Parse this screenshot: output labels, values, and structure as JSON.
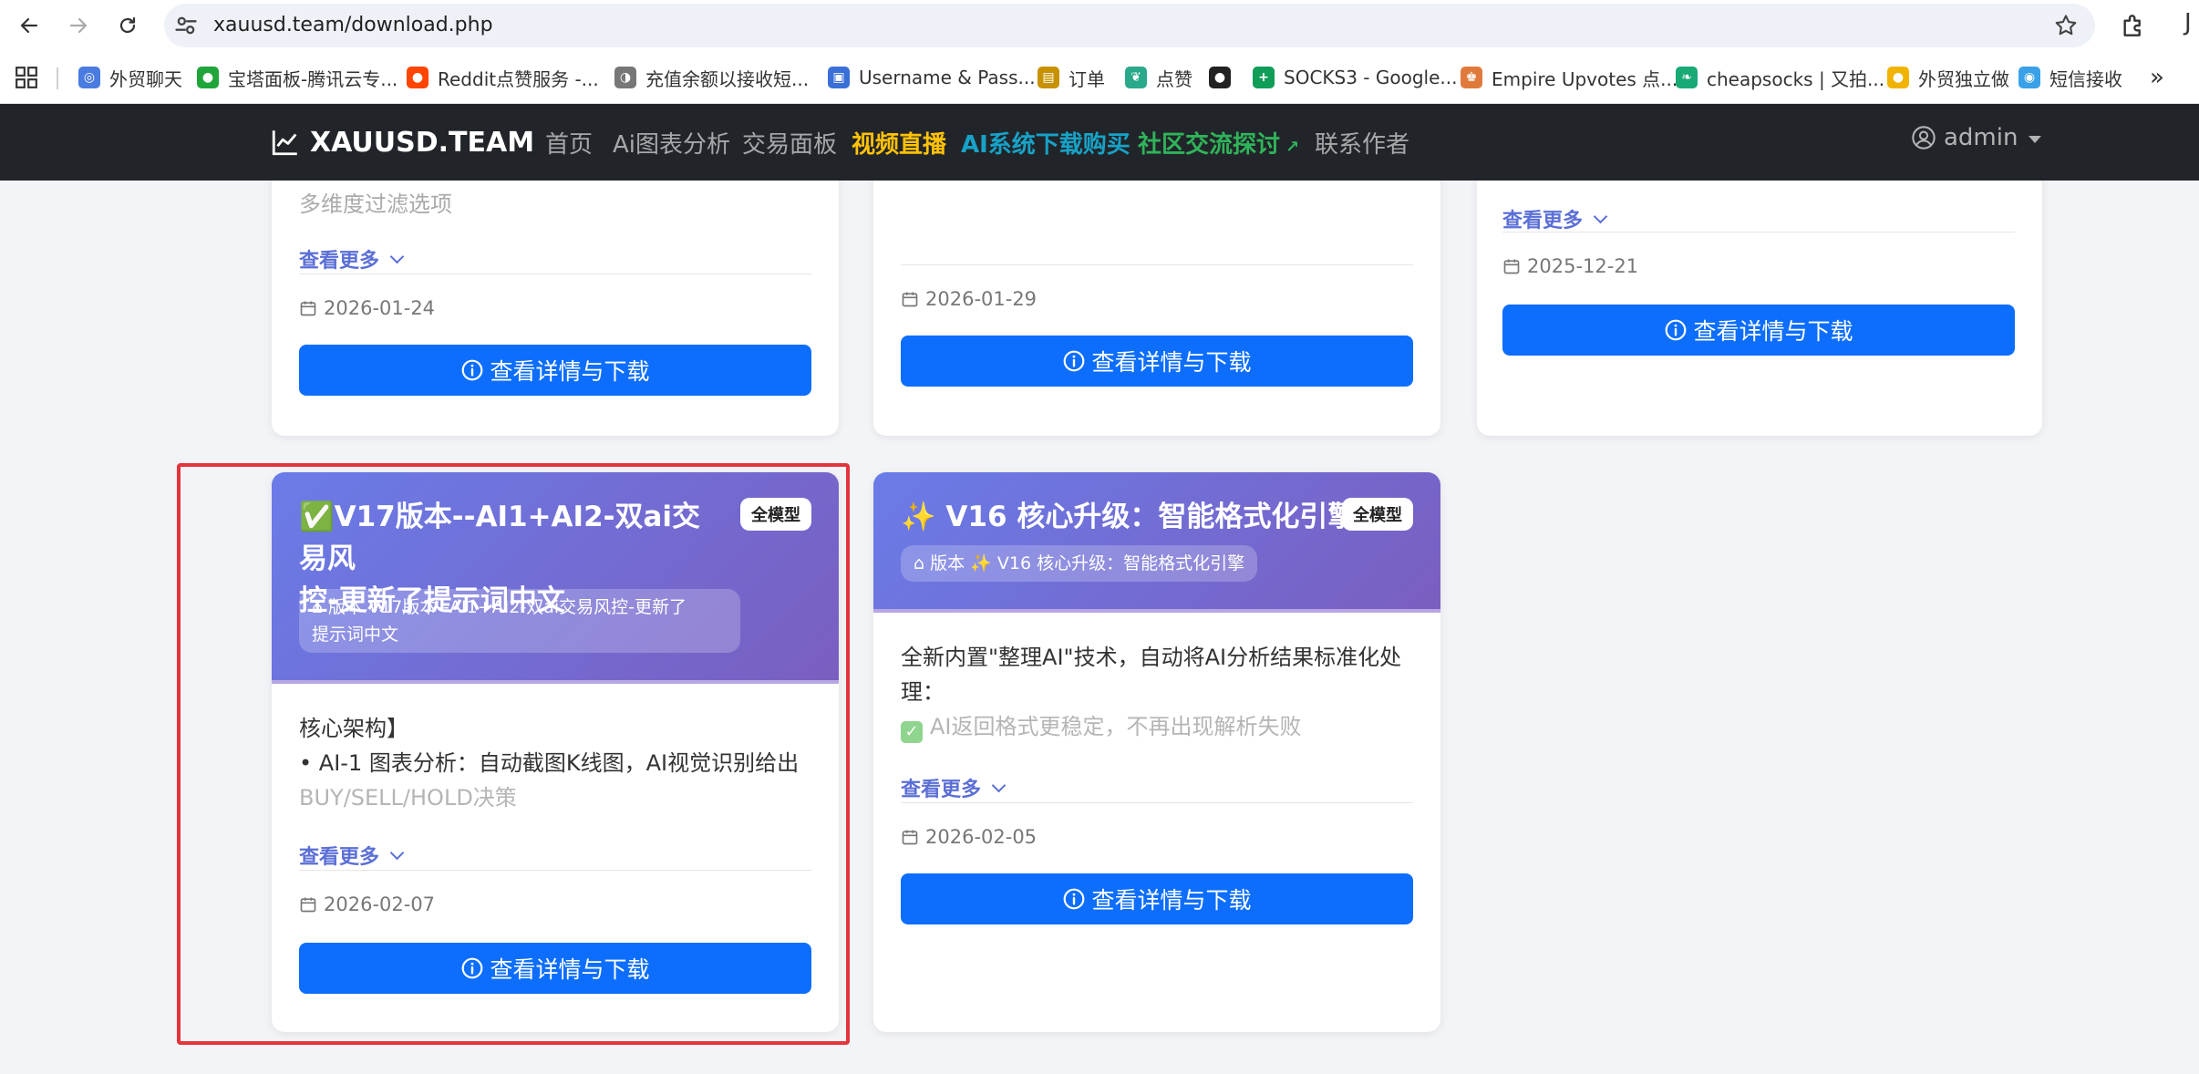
{
  "browser": {
    "url": "xauusd.team/download.php",
    "bookmarks": [
      {
        "label": "外贸聊天",
        "icon": "chat-bubble-icon",
        "color": "#4a7be0"
      },
      {
        "label": "宝塔面板-腾讯云专...",
        "icon": "shield-icon",
        "color": "#20a53a"
      },
      {
        "label": "Reddit点赞服务 -...",
        "icon": "reddit-icon",
        "color": "#ff4500"
      },
      {
        "label": "充值余额以接收短...",
        "icon": "sms-icon",
        "color": "#777777"
      },
      {
        "label": "Username & Pass...",
        "icon": "login-icon",
        "color": "#3b6fd8"
      },
      {
        "label": "订单",
        "icon": "table-icon",
        "color": "#c79100"
      },
      {
        "label": "点赞",
        "icon": "like-icon",
        "color": "#2aa98a"
      },
      {
        "label": "",
        "icon": "globe-icon",
        "color": "#222222"
      },
      {
        "label": "SOCKS3 - Google...",
        "icon": "sheets-icon",
        "color": "#0f9d58"
      },
      {
        "label": "Empire Upvotes 点...",
        "icon": "crown-icon",
        "color": "#e07a3c"
      },
      {
        "label": "cheapsocks | 又拍...",
        "icon": "leaf-icon",
        "color": "#19a974"
      },
      {
        "label": "外贸独立做",
        "icon": "coin-icon",
        "color": "#f0b400"
      },
      {
        "label": "短信接收",
        "icon": "message-icon",
        "color": "#3aa0e8"
      }
    ],
    "more_glyph": "»",
    "profile_glyph": "J"
  },
  "nav": {
    "brand": "XAUUSD.TEAM",
    "links": [
      {
        "label": "首页",
        "color": "rgba(255,255,255,0.6)",
        "bold": false
      },
      {
        "label": "Ai图表分析",
        "color": "rgba(255,255,255,0.6)",
        "bold": false
      },
      {
        "label": "交易面板",
        "color": "rgba(255,255,255,0.6)",
        "bold": false
      },
      {
        "label": "视频直播",
        "color": "#ffc107",
        "bold": true
      },
      {
        "label": "AI系统下载购买",
        "color": "#17a2c8",
        "bold": true
      },
      {
        "label": "社区交流探讨",
        "color": "#2fb45a",
        "bold": true
      },
      {
        "label": "联系作者",
        "color": "rgba(255,255,255,0.6)",
        "bold": false
      }
    ],
    "user": "admin"
  },
  "cards": {
    "top_left": {
      "faded_text": "多维度过滤选项",
      "more": "查看更多",
      "date": "2026-01-24",
      "button": "查看详情与下载"
    },
    "top_middle": {
      "date": "2026-01-29",
      "button": "查看详情与下载"
    },
    "top_right": {
      "more": "查看更多",
      "date": "2025-12-21",
      "button": "查看详情与下载"
    },
    "v17": {
      "title_icon": "✅",
      "title_line1": "V17版本--AI1+AI2-双ai交易风",
      "title_line2": "控-更新了提示词中文",
      "badge": "全模型",
      "tag_line1": "版本 V17版本--AI1+AI2-双ai交易风控-更新了",
      "tag_line2": "提示词中文",
      "desc_line1": "核心架构】",
      "desc_line2": "• AI-1 图表分析：自动截图K线图，AI视觉识别给出",
      "desc_line3": "BUY/SELL/HOLD决策",
      "more": "查看更多",
      "date": "2026-02-07",
      "button": "查看详情与下载"
    },
    "v16": {
      "title_icon": "✨",
      "title": "V16 核心升级：智能格式化引擎",
      "badge": "全模型",
      "tag_prefix": "版本",
      "tag_icon": "✨",
      "tag_text": "V16 核心升级：智能格式化引擎",
      "desc_line1": "全新内置\"整理AI\"技术，自动将AI分析结果标准化处",
      "desc_line2": "理：",
      "desc_line3": "AI返回格式更稳定，不再出现解析失败",
      "more": "查看更多",
      "date": "2026-02-05",
      "button": "查看详情与下载"
    }
  },
  "colors": {
    "primary": "#0d6efd",
    "highlight": "#e5343b",
    "navbar": "#212529"
  }
}
